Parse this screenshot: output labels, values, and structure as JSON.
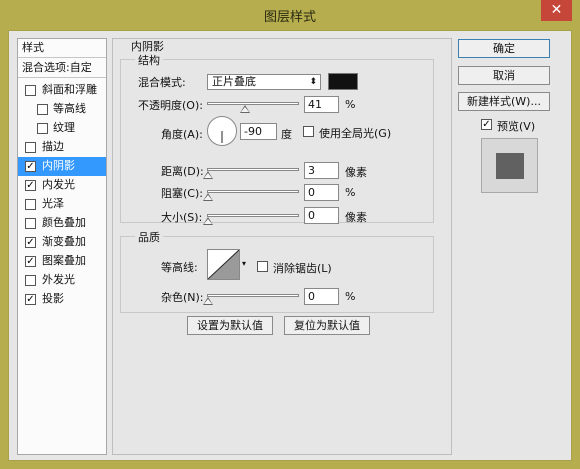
{
  "window": {
    "title": "图层样式",
    "close_glyph": "✕"
  },
  "left_panel": {
    "header": "样式",
    "blend_options": "混合选项:自定",
    "items": [
      {
        "label": "斜面和浮雕",
        "checked": false
      },
      {
        "label": "等高线",
        "checked": false
      },
      {
        "label": "纹理",
        "checked": false
      },
      {
        "label": "描边",
        "checked": false
      },
      {
        "label": "内阴影",
        "checked": true,
        "selected": true
      },
      {
        "label": "内发光",
        "checked": true
      },
      {
        "label": "光泽",
        "checked": false
      },
      {
        "label": "颜色叠加",
        "checked": false
      },
      {
        "label": "渐变叠加",
        "checked": true
      },
      {
        "label": "图案叠加",
        "checked": true
      },
      {
        "label": "外发光",
        "checked": false
      },
      {
        "label": "投影",
        "checked": true
      }
    ],
    "check_glyph": "✓"
  },
  "inner_shadow": {
    "section_title": "内阴影",
    "structure": {
      "title": "结构",
      "blend_mode_label": "混合模式:",
      "blend_mode_value": "正片叠底",
      "blend_mode_arrow": "⬍",
      "shadow_color": "#111111",
      "opacity_label": "不透明度(O):",
      "opacity_value": "41",
      "opacity_unit": "%",
      "opacity_fraction": 0.41,
      "angle_label": "角度(A):",
      "angle_value": "-90",
      "angle_unit": "度",
      "global_light_label": "使用全局光(G)",
      "global_light_checked": false,
      "distance_label": "距离(D):",
      "distance_value": "3",
      "distance_unit": "像素",
      "choke_label": "阻塞(C):",
      "choke_value": "0",
      "choke_unit": "%",
      "size_label": "大小(S):",
      "size_value": "0",
      "size_unit": "像素"
    },
    "quality": {
      "title": "品质",
      "contour_label": "等高线:",
      "antialias_label": "消除锯齿(L)",
      "antialias_checked": false,
      "noise_label": "杂色(N):",
      "noise_value": "0",
      "noise_unit": "%"
    },
    "make_default": "设置为默认值",
    "reset_default": "复位为默认值"
  },
  "right_panel": {
    "ok": "确定",
    "cancel": "取消",
    "new_style": "新建样式(W)...",
    "preview_label": "预览(V)",
    "preview_checked": true,
    "check_glyph": "✓"
  }
}
